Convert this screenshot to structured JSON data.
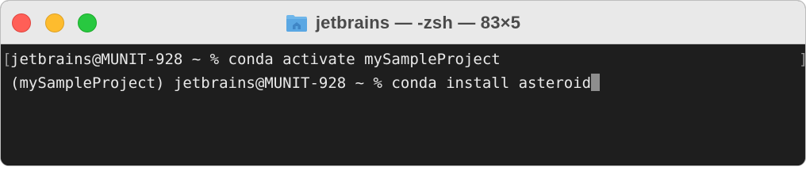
{
  "window": {
    "title": "jetbrains — -zsh — 83×5",
    "title_icon": "folder-home-icon",
    "colors": {
      "close": "#ff5f57",
      "minimize": "#febc2e",
      "zoom": "#28c840",
      "terminal_bg": "#1e1e1e",
      "terminal_text": "#e8e8e8"
    }
  },
  "terminal": {
    "lines": [
      "jetbrains@MUNIT-928 ~ % conda activate mySampleProject",
      "(mySampleProject) jetbrains@MUNIT-928 ~ % conda install asteroid"
    ],
    "left_bracket": "[",
    "right_bracket": "]"
  }
}
